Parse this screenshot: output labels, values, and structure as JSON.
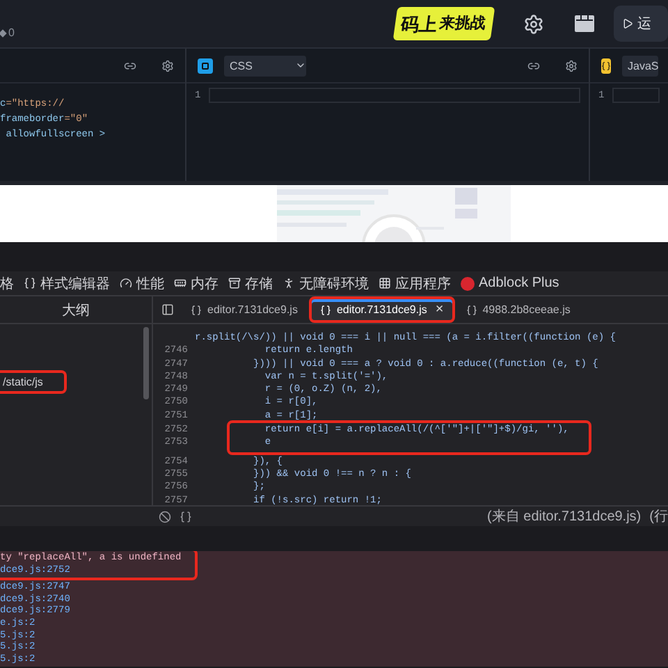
{
  "top_bar": {
    "counter": "0",
    "logo": [
      "码上",
      "来挑战"
    ],
    "run_button": "运"
  },
  "editors": [
    {
      "kind": "html",
      "code": [
        {
          "name": "c",
          "value": "=\"https://"
        },
        {
          "name": "frameborder",
          "value": "=\"0\""
        },
        {
          "name": " allowfullscreen >"
        }
      ]
    },
    {
      "kind": "css",
      "language": "CSS",
      "line_numbers": [
        "1"
      ]
    },
    {
      "kind": "js",
      "language": "JavaS",
      "line_numbers": [
        "1"
      ]
    }
  ],
  "devtools": {
    "tools": [
      {
        "label": "格"
      },
      {
        "label": "样式编辑器"
      },
      {
        "label": "性能"
      },
      {
        "label": "内存"
      },
      {
        "label": "存储"
      },
      {
        "label": "无障碍环境"
      },
      {
        "label": "应用程序"
      },
      {
        "label": "Adblock Plus"
      }
    ],
    "outline_title": "大纲",
    "tabs": [
      {
        "label": "editor.7131dce9.js",
        "selected": false,
        "highlighted": false
      },
      {
        "label": "editor.7131dce9.js",
        "selected": true,
        "highlighted": true,
        "close": "×"
      },
      {
        "label": "4988.2b8ceeae.js",
        "selected": false,
        "highlighted": false
      }
    ],
    "sidebar_items": [
      {
        "label": "/static/js",
        "highlighted": true
      }
    ],
    "code_lines": [
      {
        "text": "r.split(/\\s/)) || void 0 === i || null === (a = i.filter((function (e) {",
        "highlighted": false
      },
      {
        "number": "2746",
        "text": "            return e.length",
        "highlighted": false
      },
      {
        "number": "2747",
        "text": "          }))) || void 0 === a ? void 0 : a.reduce((function (e, t) {",
        "highlighted": false
      },
      {
        "number": "2748",
        "text": "            var n = t.split('='),",
        "highlighted": false
      },
      {
        "number": "2749",
        "text": "            r = (0, o.Z) (n, 2),",
        "highlighted": false
      },
      {
        "number": "2750",
        "text": "            i = r[0],",
        "highlighted": false
      },
      {
        "number": "2751",
        "text": "            a = r[1];",
        "highlighted": false
      },
      {
        "number": "2752",
        "text": "            return e[i] = a.replaceAll(/(^['\"]+|['\"]+$)/gi, ''),",
        "highlighted": true
      },
      {
        "number": "2753",
        "text": "            e",
        "highlighted": true
      },
      {
        "number": "2754",
        "text": "          }), {",
        "highlighted": false
      },
      {
        "number": "2755",
        "text": "          })) && void 0 !== n ? n : {",
        "highlighted": false
      },
      {
        "number": "2756",
        "text": "          };",
        "highlighted": false
      },
      {
        "number": "2757",
        "text": "          if (!s.src) return !1;",
        "highlighted": false
      }
    ],
    "status": [
      "(来自 editor.7131dce9.js)",
      "(行"
    ],
    "console": [
      {
        "kind": "message",
        "text": "ty \"replaceAll\", a is undefined",
        "highlighted": true
      },
      {
        "kind": "link",
        "text": "dce9.js:2752",
        "highlighted": true
      },
      {
        "kind": "link",
        "text": "dce9.js:2747",
        "highlighted": false
      },
      {
        "kind": "link",
        "text": "dce9.js:2740",
        "highlighted": false
      },
      {
        "kind": "link",
        "text": "dce9.js:2779",
        "highlighted": false
      },
      {
        "kind": "link",
        "text": "e.js:2",
        "highlighted": false
      },
      {
        "kind": "link",
        "text": "5.js:2",
        "highlighted": false
      },
      {
        "kind": "link",
        "text": "5.js:2",
        "highlighted": false
      },
      {
        "kind": "link",
        "text": "5.js:2",
        "highlighted": false
      }
    ]
  }
}
